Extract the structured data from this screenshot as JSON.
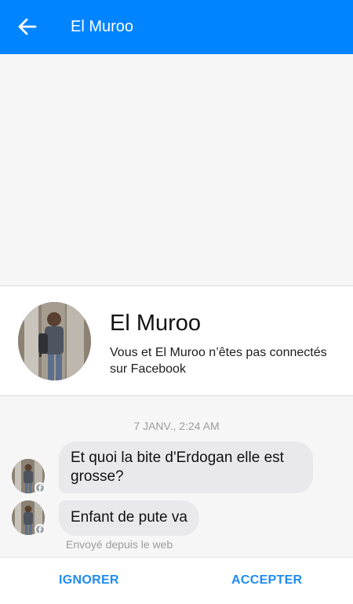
{
  "appbar": {
    "title": "El Muroo",
    "back_icon": "arrow-left-icon",
    "background": "#0084ff"
  },
  "profile": {
    "name": "El Muroo",
    "subtitle": "Vous et El Muroo n’êtes pas connectés sur Facebook"
  },
  "conversation": {
    "timestamp": "7 JANV., 2:24 AM",
    "messages": [
      {
        "text": "Et quoi la bite d'Erdogan elle est grosse?"
      },
      {
        "text": "Enfant de pute va"
      }
    ],
    "sent_via": "Envoyé depuis le web"
  },
  "actions": {
    "ignore_label": "IGNORER",
    "accept_label": "ACCEPTER",
    "accent": "#1f8bf0"
  }
}
